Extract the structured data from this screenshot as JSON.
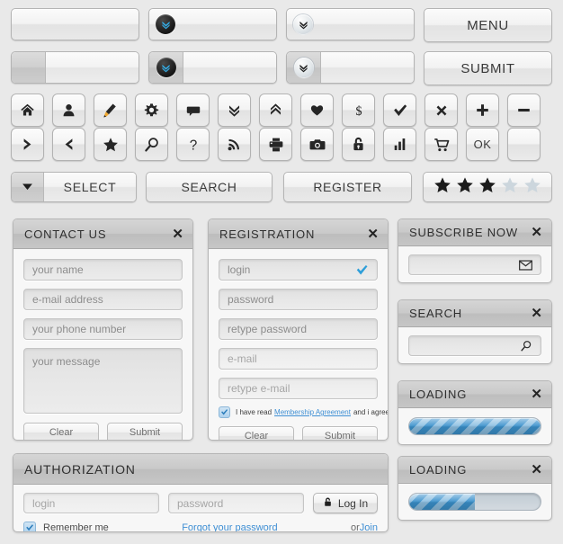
{
  "palette": {
    "page_bg": "#e9e9e9",
    "accent_blue": "#3f8fd4",
    "progress_blue": "#3b92cd",
    "chevron_blue": "#35a9e0",
    "star_on": "#1c1c1c",
    "star_off": "#ccd6dd"
  },
  "top_bars": {
    "row1": [
      {
        "name": "plain-bar",
        "type": "plain",
        "label": ""
      },
      {
        "name": "dropdown-bar-dark",
        "type": "split-dark",
        "badge_icon": "double-chevron-down-icon",
        "label": ""
      },
      {
        "name": "dropdown-bar-light",
        "type": "split-light",
        "badge_icon": "double-chevron-down-icon",
        "label": ""
      },
      {
        "name": "menu-button",
        "type": "button",
        "label": "MENU"
      }
    ],
    "row2": [
      {
        "name": "segmented-bar",
        "type": "seg-plain",
        "label": ""
      },
      {
        "name": "dropdown-seg-dark",
        "type": "seg-dark",
        "badge_icon": "double-chevron-down-icon",
        "label": ""
      },
      {
        "name": "dropdown-seg-light",
        "type": "seg-light",
        "badge_icon": "double-chevron-down-icon",
        "label": ""
      },
      {
        "name": "submit-button",
        "type": "button",
        "label": "SUBMIT"
      }
    ]
  },
  "icon_row_1": [
    {
      "icon": "home-icon"
    },
    {
      "icon": "user-icon"
    },
    {
      "icon": "pencil-icon"
    },
    {
      "icon": "gear-icon"
    },
    {
      "icon": "comment-icon"
    },
    {
      "icon": "double-chevron-down-icon"
    },
    {
      "icon": "double-chevron-up-icon"
    },
    {
      "icon": "heart-icon"
    },
    {
      "icon": "dollar-icon"
    },
    {
      "icon": "check-icon"
    },
    {
      "icon": "close-x-icon"
    },
    {
      "icon": "plus-icon"
    },
    {
      "icon": "minus-icon"
    }
  ],
  "icon_row_2": [
    {
      "icon": "chevron-right-icon"
    },
    {
      "icon": "chevron-left-icon"
    },
    {
      "icon": "star-icon"
    },
    {
      "icon": "search-icon"
    },
    {
      "icon": "question-icon"
    },
    {
      "icon": "rss-icon"
    },
    {
      "icon": "printer-icon"
    },
    {
      "icon": "camera-icon"
    },
    {
      "icon": "lock-icon"
    },
    {
      "icon": "bar-chart-icon"
    },
    {
      "icon": "cart-icon"
    },
    {
      "icon": "ok-label",
      "label": "OK"
    },
    {
      "icon": "blank-icon"
    }
  ],
  "action_row": {
    "select": {
      "label": "SELECT",
      "arrow_icon": "triangle-down-icon"
    },
    "search": {
      "label": "SEARCH"
    },
    "register": {
      "label": "REGISTER"
    },
    "rating": {
      "filled": 3,
      "total": 5,
      "icon": "star-icon"
    }
  },
  "contact_panel": {
    "title": "CONTACT US",
    "close_icon": "close-x-icon",
    "fields": [
      {
        "name": "name-field",
        "placeholder": "your name"
      },
      {
        "name": "email-field",
        "placeholder": "e-mail address"
      },
      {
        "name": "phone-field",
        "placeholder": "your phone number"
      }
    ],
    "message": {
      "name": "message-field",
      "placeholder": "your message"
    },
    "clear_label": "Clear",
    "submit_label": "Submit"
  },
  "registration_panel": {
    "title": "REGISTRATION",
    "close_icon": "close-x-icon",
    "fields": [
      {
        "name": "login-field",
        "placeholder": "login",
        "valid": true,
        "valid_icon": "check-icon",
        "dim": false
      },
      {
        "name": "password-field",
        "placeholder": "password",
        "valid": false,
        "dim": false
      },
      {
        "name": "retype-password-field",
        "placeholder": "retype password",
        "valid": false,
        "dim": false
      },
      {
        "name": "email-field",
        "placeholder": "e-mail",
        "valid": false,
        "dim": true
      },
      {
        "name": "retype-email-field",
        "placeholder": "retype e-mail",
        "valid": false,
        "dim": true
      }
    ],
    "agreement": {
      "checked": true,
      "prefix": "I have read ",
      "link": "Membership Agreement",
      "suffix": " and i agree with it"
    },
    "clear_label": "Clear",
    "submit_label": "Submit"
  },
  "subscribe_panel": {
    "title": "SUBSCRIBE NOW",
    "close_icon": "close-x-icon",
    "field": {
      "placeholder": "",
      "icon": "envelope-icon"
    }
  },
  "search_panel": {
    "title": "SEARCH",
    "close_icon": "close-x-icon",
    "field": {
      "placeholder": "",
      "icon": "search-icon"
    }
  },
  "loading_panel_1": {
    "title": "LOADING",
    "close_icon": "close-x-icon",
    "progress": 100
  },
  "loading_panel_2": {
    "title": "LOADING",
    "close_icon": "close-x-icon",
    "progress": 50
  },
  "authorization_panel": {
    "title": "AUTHORIZATION",
    "login": {
      "name": "login-field",
      "placeholder": "login"
    },
    "password": {
      "name": "password-field",
      "placeholder": "password"
    },
    "login_button": {
      "label": "Log In",
      "icon": "lock-icon"
    },
    "remember": {
      "checked": true,
      "label": "Remember me"
    },
    "forgot_link": "Forgot your password",
    "or_text": "or ",
    "join_link": "Join"
  }
}
